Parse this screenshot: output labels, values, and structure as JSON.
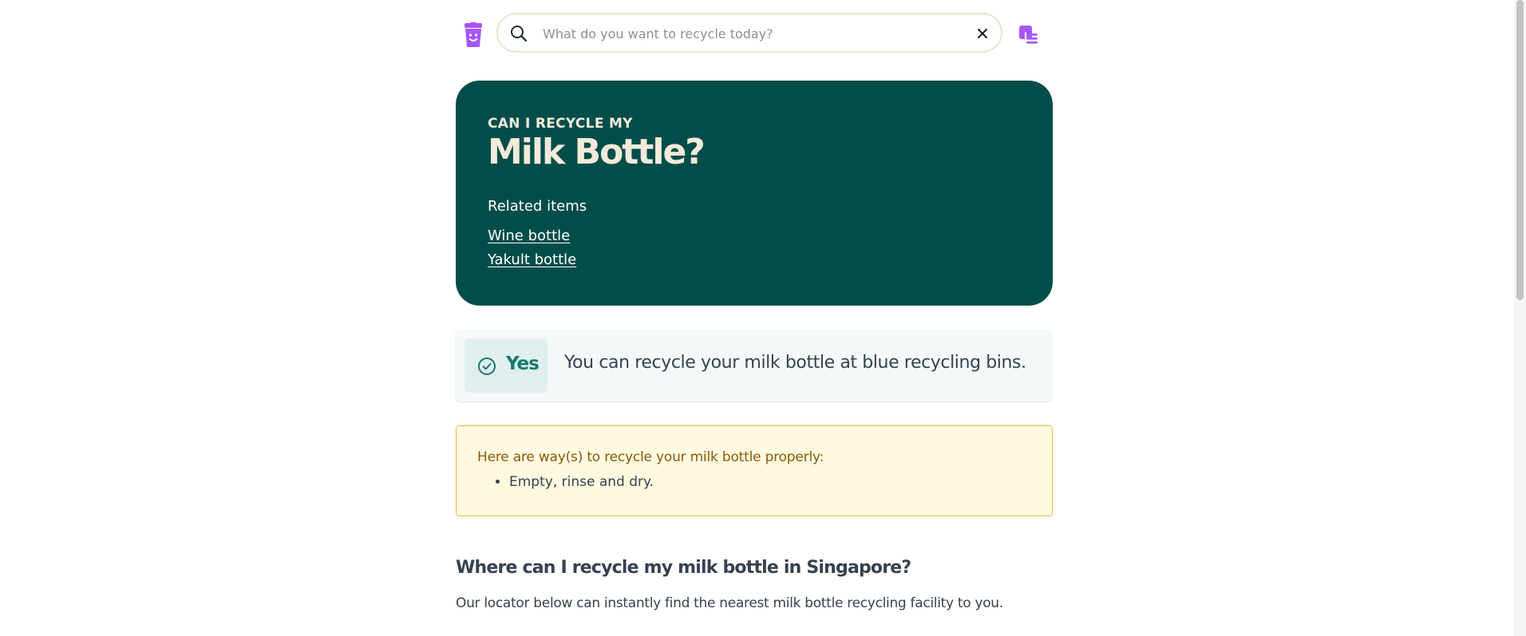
{
  "header": {
    "logo_icon": "recycle-bin-icon",
    "search": {
      "placeholder": "What do you want to recycle today?",
      "value": ""
    },
    "menu_icon": "list-menu-icon"
  },
  "hero": {
    "kicker": "CAN I RECYCLE MY",
    "title": "Milk Bottle?",
    "related_label": "Related items",
    "related_items": [
      "Wine bottle",
      "Yakult bottle"
    ]
  },
  "verdict": {
    "badge": "Yes",
    "text": "You can recycle your milk bottle at blue recycling bins."
  },
  "tips": {
    "heading": "Here are way(s) to recycle your milk bottle properly:",
    "items": [
      "Empty, rinse and dry."
    ]
  },
  "locator": {
    "heading": "Where can I recycle my milk bottle in Singapore?",
    "text": "Our locator below can instantly find the nearest milk bottle recycling facility to you."
  },
  "colors": {
    "hero_bg": "#024d4a",
    "hero_text": "#f3ead9",
    "accent_purple": "#a855f7",
    "verdict_green": "#157a76",
    "tips_bg": "#fff9e0",
    "tips_border": "#e5bd47"
  }
}
